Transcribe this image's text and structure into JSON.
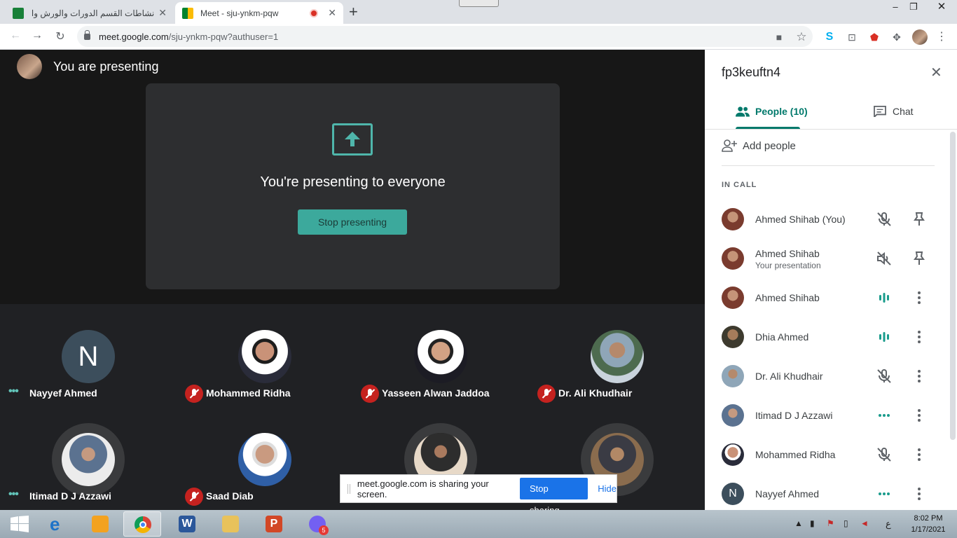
{
  "browser": {
    "tabs": [
      {
        "title": "نشاطات القسم الدورات والورش وال",
        "active": false
      },
      {
        "title": "Meet - sju-ynkm-pqw",
        "active": true
      }
    ],
    "url_host": "meet.google.com",
    "url_path": "/sju-ynkm-pqw?authuser=1",
    "new_tab": "+"
  },
  "stage": {
    "presenting_label": "You are presenting",
    "presenting_message": "You're presenting to everyone",
    "stop_presenting": "Stop presenting"
  },
  "tiles": [
    {
      "name": "Nayyef Ahmed",
      "status": "talking-dots",
      "avatar_letter": "N"
    },
    {
      "name": "Mohammed Ridha",
      "status": "muted"
    },
    {
      "name": "Yasseen Alwan Jaddoa",
      "status": "muted"
    },
    {
      "name": "Dr. Ali Khudhair",
      "status": "muted"
    },
    {
      "name": "Itimad D J Azzawi",
      "status": "talking-dots"
    },
    {
      "name": "Saad Diab",
      "status": "muted"
    },
    {
      "name": "",
      "status": "none"
    },
    {
      "name": "",
      "status": "none"
    }
  ],
  "sharebar": {
    "text": "meet.google.com is sharing your screen.",
    "stop": "Stop sharing",
    "hide": "Hide"
  },
  "panel": {
    "meeting_id": "fp3keuftn4",
    "tab_people": "People (10)",
    "tab_chat": "Chat",
    "add_people": "Add people",
    "section": "IN CALL",
    "people": [
      {
        "name": "Ahmed Shihab (You)",
        "sub": "",
        "status": "mic-off",
        "action": "pin"
      },
      {
        "name": "Ahmed Shihab",
        "sub": "Your presentation",
        "status": "sound-off",
        "action": "pin"
      },
      {
        "name": "Ahmed Shihab",
        "sub": "",
        "status": "speaking",
        "action": "more"
      },
      {
        "name": "Dhia Ahmed",
        "sub": "",
        "status": "speaking",
        "action": "more"
      },
      {
        "name": "Dr. Ali Khudhair",
        "sub": "",
        "status": "mic-off",
        "action": "more"
      },
      {
        "name": "Itimad D J Azzawi",
        "sub": "",
        "status": "dots",
        "action": "more"
      },
      {
        "name": "Mohammed Ridha",
        "sub": "",
        "status": "mic-off",
        "action": "more"
      },
      {
        "name": "Nayyef Ahmed",
        "sub": "",
        "status": "dots",
        "action": "more",
        "avatar_letter": "N"
      }
    ]
  },
  "taskbar": {
    "time": "8:02 PM",
    "date": "1/17/2021",
    "lang": "ع",
    "viber_badge": "5"
  },
  "colors": {
    "accent": "#00796b",
    "present_btn": "#3ca99c",
    "mute_red": "#c5221f",
    "share_blue": "#1a73e8"
  }
}
